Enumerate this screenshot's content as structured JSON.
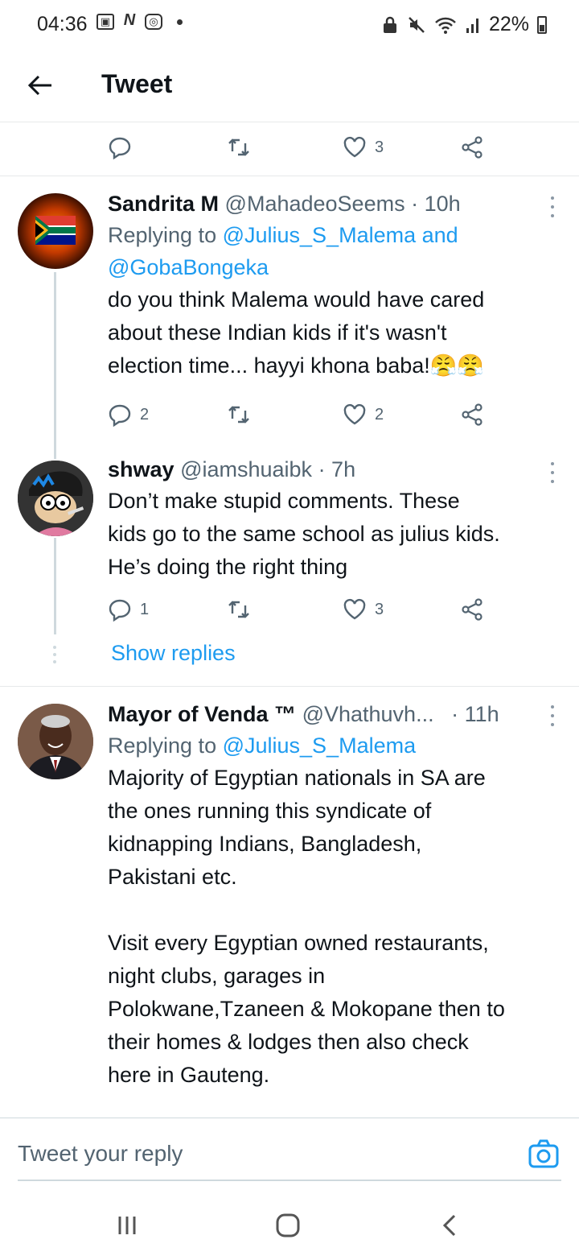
{
  "status_bar": {
    "time": "04:36",
    "battery": "22%",
    "icons": [
      "image-icon",
      "n-icon",
      "instagram-icon",
      "dot-icon",
      "lock-icon",
      "mute-icon",
      "wifi-icon",
      "signal-icon",
      "battery-icon"
    ]
  },
  "header": {
    "title": "Tweet"
  },
  "top_actions": {
    "reply_count": "",
    "like_count": "3"
  },
  "tweets": [
    {
      "name": "Sandrita M",
      "handle": "@MahadeoSeems",
      "time": "· 10h",
      "replying_prefix": "Replying to ",
      "mention_1": "@Julius_S_Malema",
      "and_text": " and",
      "mention_2": "@GobaBongeka",
      "text": "do you think Malema would have cared\nabout these Indian kids if it's wasn't\nelection time... hayyi khona baba!😤😤",
      "reply_count": "2",
      "like_count": "2"
    },
    {
      "name": "shway",
      "handle": "@iamshuaibk",
      "time": "· 7h",
      "text": "Don’t make stupid comments. These\nkids go to the same school as julius kids.\nHe’s doing the right thing",
      "reply_count": "1",
      "like_count": "3"
    },
    {
      "name": "Mayor of Venda ™",
      "handle": "@Vhathuvh...",
      "time": "· 11h",
      "replying_prefix": "Replying to ",
      "mention_1": "@Julius_S_Malema",
      "text": "Majority of Egyptian nationals in SA are\nthe ones running this syndicate of\nkidnapping Indians, Bangladesh,\nPakistani etc.\n\nVisit every Egyptian owned restaurants,\nnight clubs, garages in\nPolokwane,Tzaneen & Mokopane then to\ntheir homes & lodges then also check\nhere in Gauteng."
    }
  ],
  "show_replies": "Show replies",
  "reply_bar": {
    "placeholder": "Tweet your reply"
  },
  "colors": {
    "link": "#1d9bf0",
    "secondary_text": "#536471",
    "divider": "#e7e9ea"
  }
}
